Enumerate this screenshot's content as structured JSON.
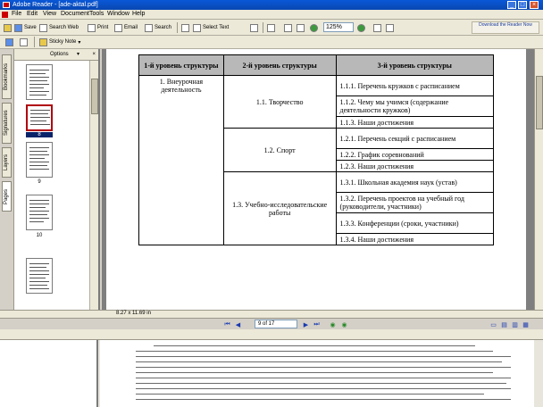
{
  "window": {
    "title": "Adobe Reader - [ade-aktal.pdf]",
    "controls": [
      "_",
      "□",
      "×"
    ]
  },
  "menu": {
    "items": [
      "File",
      "Edit",
      "View",
      "Document",
      "Tools",
      "Window",
      "Help"
    ]
  },
  "toolbar": {
    "save": "Save",
    "search_web": "Search Web",
    "print": "Print",
    "email": "Email",
    "search": "Search",
    "select_text": "Select Text",
    "zoom_value": "125%",
    "ad_link": "Download the Reader Now"
  },
  "toolbar2": {
    "dropdown": "Sticky Note"
  },
  "left_tabs": [
    "Bookmarks",
    "Signatures",
    "Layers",
    "Pages"
  ],
  "thumb_panel": {
    "header": "Options",
    "close": "×",
    "page_labels": [
      "8",
      "9",
      "10"
    ]
  },
  "table": {
    "headers": [
      "1-й уровень структуры",
      "2-й уровень структуры",
      "3-й уровень структуры"
    ],
    "level1": "1. Внеурочная деятельность",
    "groups": [
      {
        "level2": "1.1. Творчество",
        "items": [
          "1.1.1. Перечень кружков с расписанием",
          "1.1.2. Чему мы учимся (содержание деятельности кружков)",
          "1.1.3. Наши достижения"
        ]
      },
      {
        "level2": "1.2. Спорт",
        "items": [
          "1.2.1. Перечень секций с расписанием",
          "1.2.2. График соревнований",
          "1.2.3. Наши достижения"
        ]
      },
      {
        "level2": "1.3. Учебно-исследовательские работы",
        "items": [
          "1.3.1. Школьная академия наук (устав)",
          "1.3.2. Перечень проектов на учебный год (руководители, участники)",
          "1.3.3. Конференции (сроки, участники)",
          "1.3.4. Наши достижения"
        ]
      }
    ]
  },
  "status": {
    "page_size": "8.27 x 11.69 in"
  },
  "nav": {
    "page_box": "9 of 17"
  },
  "colors": {
    "titlebar": "#0847b0",
    "header_cell": "#b8b8b8",
    "selected_thumb": "#b0000a"
  }
}
